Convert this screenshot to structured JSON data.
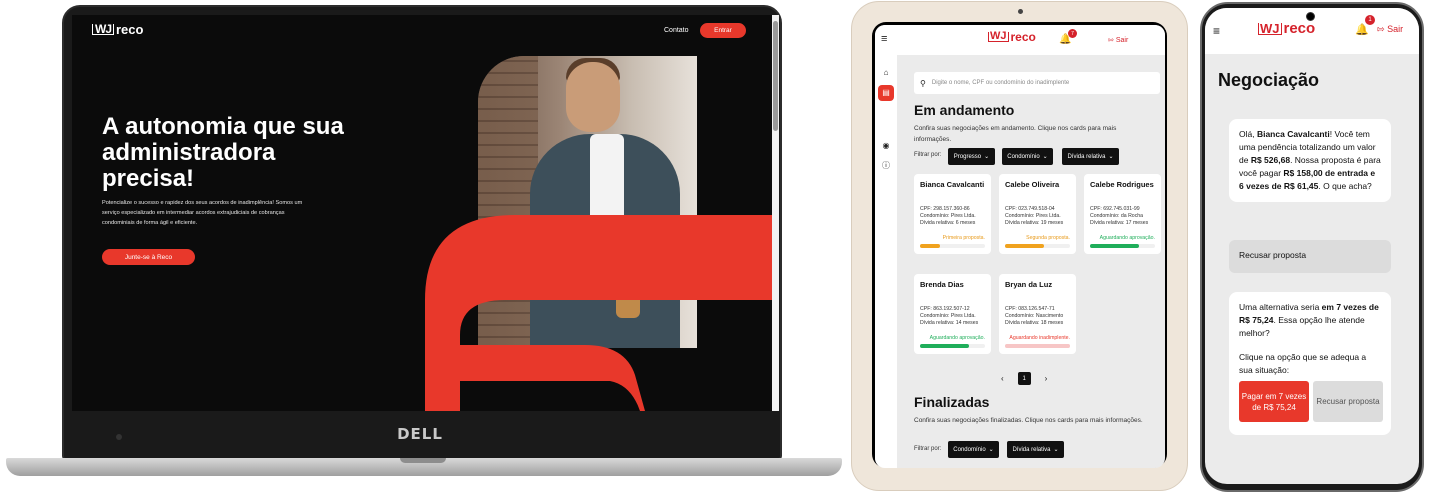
{
  "laptop": {
    "brand": "reco",
    "logo_mark": "WJ",
    "nav_contact": "Contato",
    "nav_login": "Entrar",
    "hero_title": "A autonomia que sua administradora precisa!",
    "hero_description": "Potencialize o sucesso e rapidez dos seus acordos de inadimplência! Somos um serviço especializado em intermediar acordos extrajudiciais de cobranças condominiais de forma ágil e eficiente.",
    "cta_label": "Junte-se à Reco",
    "device_logo": "DELL",
    "accent_color": "#e8382b"
  },
  "tablet": {
    "brand": "reco",
    "logo_mark": "WJ",
    "notifications": "7",
    "logout_label": "Sair",
    "search_placeholder": "Digite o nome, CPF ou condomínio do inadimplente",
    "section_active_title": "Em andamento",
    "section_active_subtitle": "Confira suas negociações em andamento. Clique nos cards para mais informações.",
    "filter_label": "Filtrar por:",
    "filters": [
      "Progresso",
      "Condomínio",
      "Dívida relativa"
    ],
    "filters_finished": [
      "Condomínio",
      "Dívida relativa"
    ],
    "cards": [
      {
        "name": "Bianca Cavalcanti",
        "cpf": "CPF: 298.157.360-86",
        "condo": "Condomínio: Pires Ltda.",
        "debt": "Dívida relativa: 6 meses",
        "status": "Primeira proposta.",
        "status_color": "#e89a1a",
        "progress": 0.3,
        "progress_color": "#f0a21e"
      },
      {
        "name": "Calebe Oliveira",
        "cpf": "CPF: 023.749.518-04",
        "condo": "Condomínio: Pires Ltda.",
        "debt": "Dívida relativa: 19 meses",
        "status": "Segunda proposta.",
        "status_color": "#e89a1a",
        "progress": 0.6,
        "progress_color": "#f0a21e"
      },
      {
        "name": "Calebe Rodrigues",
        "cpf": "CPF: 692.745.031-99",
        "condo": "Condomínio: da Rocha",
        "debt": "Dívida relativa: 17 meses",
        "status": "Aguardando aprovação.",
        "status_color": "#1fae5a",
        "progress": 0.75,
        "progress_color": "#1fae5a"
      },
      {
        "name": "Brenda Dias",
        "cpf": "CPF: 863.192.507-12",
        "condo": "Condomínio: Pires Ltda.",
        "debt": "Dívida relativa: 14 meses",
        "status": "Aguardando aprovação.",
        "status_color": "#1fae5a",
        "progress": 0.75,
        "progress_color": "#1fae5a"
      },
      {
        "name": "Bryan da Luz",
        "cpf": "CPF: 083.126.547-71",
        "condo": "Condomínio: Nascimento",
        "debt": "Dívida relativa: 18 meses",
        "status": "Aguardando inadimplente.",
        "status_color": "#e8382b",
        "progress": 1.0,
        "progress_color": "#f7c6c6"
      }
    ],
    "page_prev": "‹",
    "page_current": "1",
    "page_next": "›",
    "section_done_title": "Finalizadas",
    "section_done_subtitle": "Confira suas negociações finalizadas. Clique nos cards para mais informações."
  },
  "phone": {
    "brand": "reco",
    "logo_mark": "WJ",
    "notifications": "1",
    "logout_label": "Sair",
    "page_title": "Negociação",
    "msg1_pre": "Olá, ",
    "msg1_name": "Bianca Cavalcanti",
    "msg1_mid": "! Você tem uma pendência totalizando um valor de ",
    "msg1_total": "R$ 526,68",
    "msg1_mid2": ". Nossa proposta é para você pagar ",
    "msg1_entry": "R$ 158,00 de entrada e 6 vezes de R$ 61,45",
    "msg1_end": ". O que acha?",
    "reply_label": "Recusar proposta",
    "msg2_pre": "Uma alternativa seria ",
    "msg2_bold": "em 7 vezes de R$ 75,24",
    "msg2_end": ". Essa opção lhe atende melhor?",
    "msg2_prompt": "Clique na opção que se adequa a sua situação:",
    "option_accept": "Pagar em 7 vezes de R$ 75,24",
    "option_refuse": "Recusar proposta"
  }
}
